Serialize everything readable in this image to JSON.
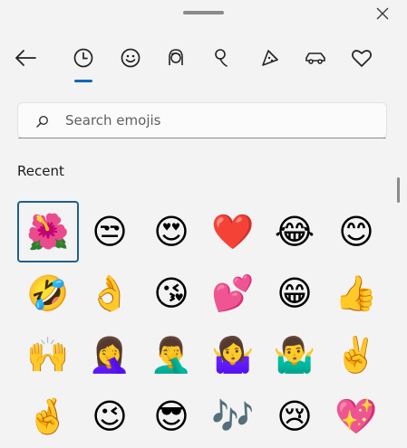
{
  "header": {
    "close_glyph": "✕"
  },
  "tabs": [
    {
      "name": "back",
      "icon": "back-arrow-icon"
    },
    {
      "name": "recently-used",
      "icon": "clock-icon",
      "selected": true
    },
    {
      "name": "smileys",
      "icon": "smiley-face-icon"
    },
    {
      "name": "people",
      "icon": "person-icon"
    },
    {
      "name": "nature",
      "icon": "leaf-icon"
    },
    {
      "name": "food",
      "icon": "pizza-icon"
    },
    {
      "name": "travel",
      "icon": "car-icon"
    },
    {
      "name": "symbols",
      "icon": "heart-outline-icon"
    }
  ],
  "search": {
    "placeholder": "Search emojis",
    "value": ""
  },
  "section": {
    "title": "Recent"
  },
  "emojis": [
    "🌺",
    "😒",
    "😍",
    "❤️",
    "😂",
    "😊",
    "🤣",
    "👌",
    "😘",
    "💕",
    "😁",
    "👍",
    "🙌",
    "🤦‍♀️",
    "🤦‍♂️",
    "🤷‍♀️",
    "🤷‍♂️",
    "✌️",
    "🤞",
    "😉",
    "😎",
    "🎶",
    "😢",
    "💖"
  ],
  "colors": {
    "accent": "#0067c0",
    "selected_border": "#1f5f94",
    "background": "#f3f3f3"
  }
}
